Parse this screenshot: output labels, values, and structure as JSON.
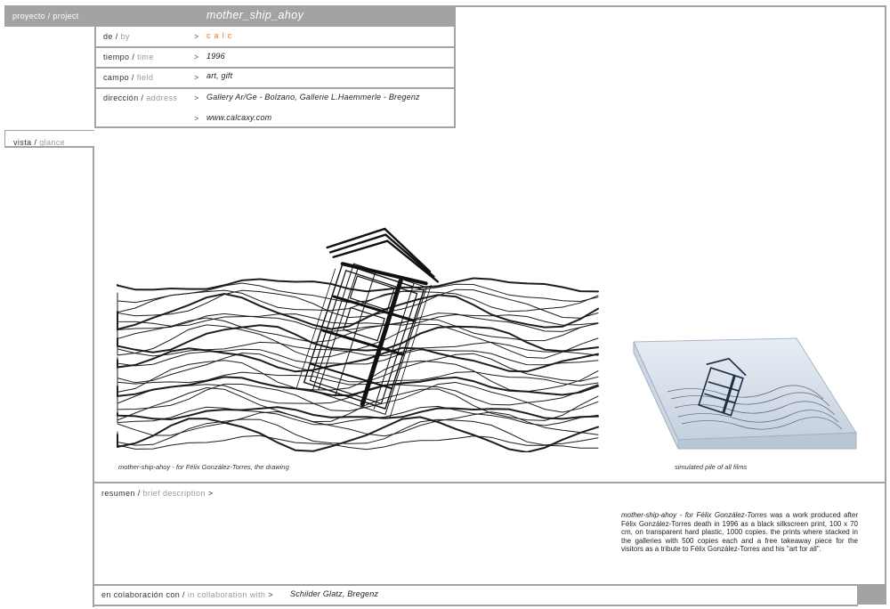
{
  "header": {
    "project_es": "proyecto",
    "project_en": "project",
    "sep": "/",
    "title": "mother_ship_ahoy"
  },
  "fields": [
    {
      "label_es": "de",
      "label_en": "by",
      "value": "c a l c",
      "accent": "#e07a1f"
    },
    {
      "label_es": "tiempo",
      "label_en": "time",
      "value": "1996"
    },
    {
      "label_es": "campo",
      "label_en": "field",
      "value": "art, gift"
    },
    {
      "label_es": "dirección",
      "label_en": "address",
      "value": "Gallery Ar/Ge - Bolzano, Gallerie L.Haemmerle - Bregenz",
      "value2": "www.calcaxy.com"
    }
  ],
  "arrow": ">",
  "view": {
    "label_es": "vista",
    "label_en": "glance"
  },
  "captions": {
    "drawing": "mother-ship-ahoy - for Félix González-Torres, the drawing",
    "pile": "simulated pile of all films"
  },
  "summary": {
    "label_es": "resumen",
    "label_en": "brief description",
    "lead": "mother-ship-ahoy - for Félix González-Torres",
    "text": " was a work produced after Félix González-Torres death in 1996 as a black silkscreen print, 100 x 70 cm, on transparent hard plastic, 1000 copies. the prints where stacked in the galleries with 500 copies each and a free takeaway piece for the visitors as a tribute to Félix González-Torres and his \"art for all\"."
  },
  "collab": {
    "label_es": "en colaboración con",
    "label_en": "in collaboration with",
    "value": "Schilder Glatz, Bregenz"
  },
  "colors": {
    "frame": "#a3a3a3",
    "accent": "#e07a1f"
  }
}
